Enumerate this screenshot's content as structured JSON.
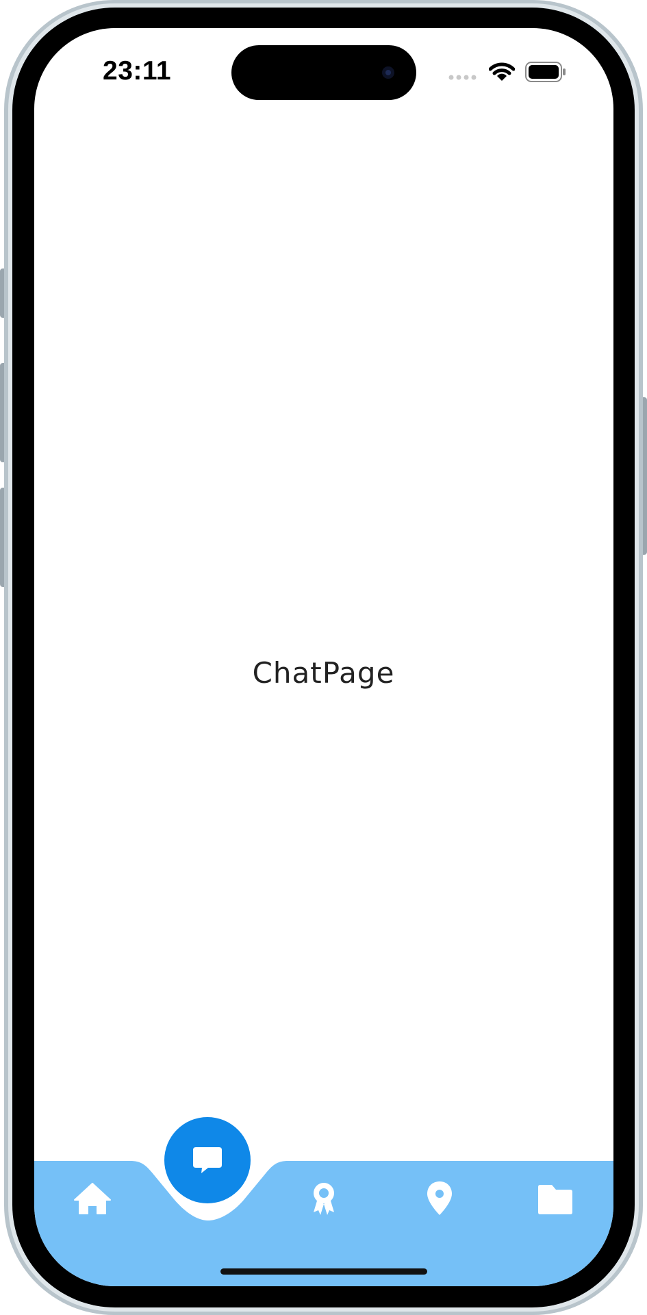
{
  "status_bar": {
    "time": "23:11",
    "icons": [
      "cellular-icon",
      "wifi-icon",
      "battery-icon"
    ]
  },
  "main": {
    "title": "ChatPage"
  },
  "bottom_nav": {
    "colors": {
      "bar": "#75C0F7",
      "active": "#0F88E8",
      "icon": "#ffffff"
    },
    "active_index": 1,
    "items": [
      {
        "icon": "home-icon"
      },
      {
        "icon": "chat-icon"
      },
      {
        "icon": "award-icon"
      },
      {
        "icon": "location-pin-icon"
      },
      {
        "icon": "folder-icon"
      }
    ]
  }
}
